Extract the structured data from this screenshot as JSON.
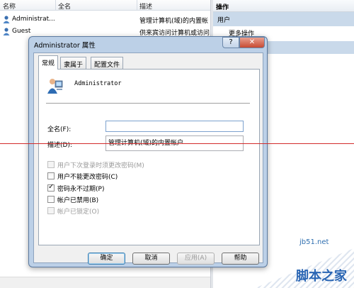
{
  "console": {
    "columns": [
      "名称",
      "全名",
      "描述"
    ],
    "users": [
      {
        "name": "Administrat...",
        "desc": "管理计算机(域)的内置帐"
      },
      {
        "name": "Guest",
        "desc": "供来宾访问计算机或访问"
      }
    ],
    "actions_title": "操作",
    "actions_section": "用户",
    "actions_more": "更多操作"
  },
  "dialog": {
    "title": "Administrator 属性",
    "help_glyph": "?",
    "close_glyph": "✕",
    "tabs": [
      "常规",
      "隶属于",
      "配置文件"
    ],
    "username": "Administrator",
    "fullname_label": "全名(F):",
    "fullname_value": "",
    "desc_label": "描述(D):",
    "desc_value": "管理计算机(域)的内置帐户",
    "checkboxes": [
      {
        "label": "用户下次登录时须更改密码(M)",
        "checked": false,
        "enabled": false
      },
      {
        "label": "用户不能更改密码(C)",
        "checked": false,
        "enabled": true
      },
      {
        "label": "密码永不过期(P)",
        "checked": true,
        "enabled": true
      },
      {
        "label": "帐户已禁用(B)",
        "checked": false,
        "enabled": true
      },
      {
        "label": "帐户已锁定(O)",
        "checked": false,
        "enabled": false
      }
    ],
    "buttons": {
      "ok": "确定",
      "cancel": "取消",
      "apply": "应用(A)",
      "help": "帮助"
    }
  },
  "watermark": {
    "site": "jb51.net",
    "name": "脚本之家"
  }
}
